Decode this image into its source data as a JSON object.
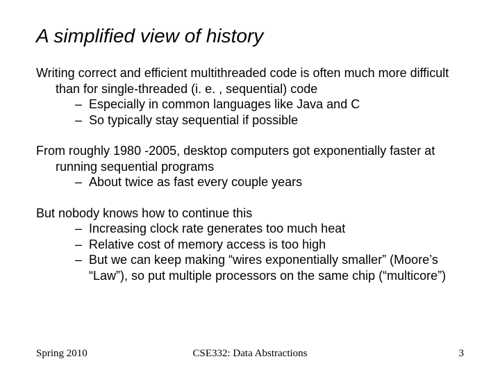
{
  "title": "A simplified view of history",
  "paragraphs": [
    {
      "lead": "Writing correct and efficient multithreaded code is often much more difficult than for single-threaded (i. e. , sequential) code",
      "subs": [
        "Especially in common languages like Java and C",
        "So typically stay sequential if possible"
      ]
    },
    {
      "lead": "From roughly 1980 -2005, desktop computers got exponentially faster at running sequential programs",
      "subs": [
        "About twice as fast every couple years"
      ]
    },
    {
      "lead": "But nobody knows how to continue this",
      "subs": [
        "Increasing clock rate generates too much heat",
        "Relative cost of memory access is too high",
        "But we can keep making “wires exponentially smaller” (Moore’s “Law”), so put multiple processors on the same chip (“multicore”)"
      ]
    }
  ],
  "footer": {
    "left": "Spring 2010",
    "center": "CSE332: Data Abstractions",
    "right": "3"
  }
}
